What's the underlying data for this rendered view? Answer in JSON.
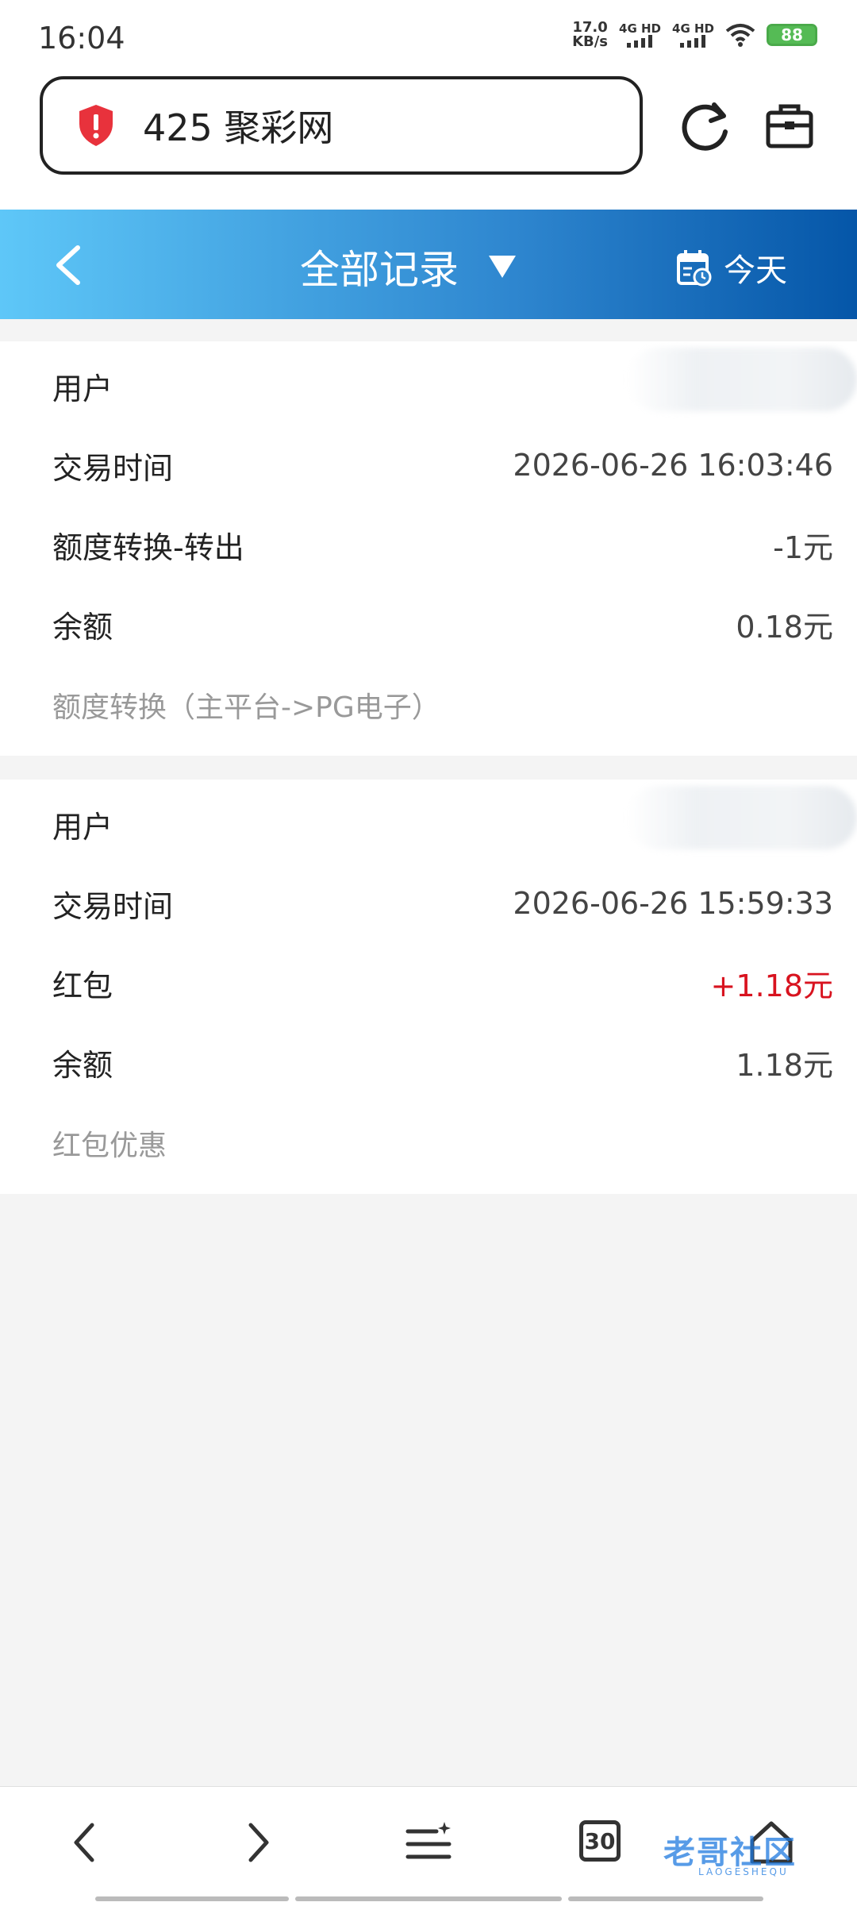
{
  "status_bar": {
    "time": "16:04",
    "net_speed_value": "17.0",
    "net_speed_unit": "KB/s",
    "signal_1_label": "4G HD",
    "signal_2_label": "4G HD",
    "battery": "88"
  },
  "browser": {
    "address": "425 聚彩网"
  },
  "header": {
    "title": "全部记录",
    "today_label": "今天"
  },
  "records": [
    {
      "user_label": "用户",
      "time_label": "交易时间",
      "time_value": "2026-06-26 16:03:46",
      "type_label": "额度转换-转出",
      "amount": "-1元",
      "balance_label": "余额",
      "balance": "0.18元",
      "note": "额度转换（主平台->PG电子）"
    },
    {
      "user_label": "用户",
      "time_label": "交易时间",
      "time_value": "2026-06-26 15:59:33",
      "type_label": "红包",
      "amount": "+1.18元",
      "balance_label": "余额",
      "balance": "1.18元",
      "note": "红包优惠"
    }
  ],
  "bottom_nav": {
    "tab_count": "30",
    "watermark": "老哥社区",
    "watermark_sub": "LAOGESHEQU"
  },
  "colors": {
    "header_gradient_start": "#5ec7f8",
    "header_gradient_end": "#0556a8",
    "positive_amount": "#d8131f",
    "shield": "#e8323c"
  }
}
